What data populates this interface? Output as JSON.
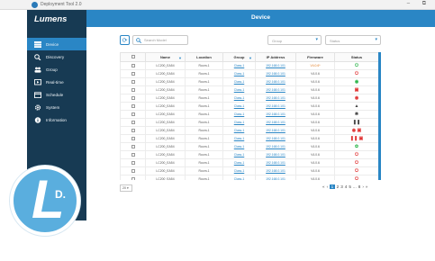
{
  "window": {
    "title": "Deployment Tool 2.0",
    "controls": "– ⧉"
  },
  "sidebar": {
    "brand": "Lumens",
    "items": [
      {
        "label": "Device",
        "icon": "device-icon",
        "active": true
      },
      {
        "label": "Discovery",
        "icon": "search-icon"
      },
      {
        "label": "Group",
        "icon": "group-icon"
      },
      {
        "label": "Real-time",
        "icon": "realtime-icon"
      },
      {
        "label": "Schedule",
        "icon": "calendar-icon"
      },
      {
        "label": "System",
        "icon": "gear-icon"
      },
      {
        "label": "Information",
        "icon": "info-icon"
      }
    ]
  },
  "header": {
    "title": "Device"
  },
  "toolbar": {
    "search_placeholder": "Search Model",
    "filter1": "Group",
    "filter2": "Status"
  },
  "table": {
    "headers": [
      "Name",
      "Location",
      "Group",
      "IP Address",
      "Firmware",
      "Status"
    ],
    "rows": [
      [
        "LC200_EA54",
        "Room-1",
        "Class-1",
        "192.168.0.101",
        "V4.0.6*",
        "status-green-power"
      ],
      [
        "LC200_EA54",
        "Room-1",
        "Class-1",
        "192.168.0.101",
        "V4.0.6",
        "status-red-power"
      ],
      [
        "LC200_EA54",
        "Room-1",
        "Class-1",
        "192.168.0.101",
        "V4.0.6",
        "status-green-record"
      ],
      [
        "LC200_EA54",
        "Room-1",
        "Class-1",
        "192.168.0.101",
        "V4.0.6",
        "status-red-stream"
      ],
      [
        "LC200_EA54",
        "Room-1",
        "Class-1",
        "192.168.0.101",
        "V4.0.6",
        "status-red-record"
      ],
      [
        "LC200_EA54",
        "Room-1",
        "Class-1",
        "192.168.0.101",
        "V4.0.6",
        "status-warning"
      ],
      [
        "LC200_EA54",
        "Room-1",
        "Class-1",
        "192.168.0.101",
        "V4.0.6",
        "status-record-multi"
      ],
      [
        "LC200_EA54",
        "Room-1",
        "Class-1",
        "192.168.0.101",
        "V4.0.6",
        "status-pause"
      ],
      [
        "LC200_EA54",
        "Room-1",
        "Class-1",
        "192.168.0.101",
        "V4.0.6",
        "status-record-stream"
      ],
      [
        "LC200_EA54",
        "Room-1",
        "Class-1",
        "192.168.0.101",
        "V4.0.6",
        "status-pause-stream"
      ],
      [
        "LC200_EA54",
        "Room-1",
        "Class-1",
        "192.168.0.101",
        "V4.0.6",
        "status-record-green"
      ],
      [
        "LC200_EA54",
        "Room-1",
        "Class-1",
        "192.168.0.101",
        "V4.0.6",
        "status-red-power"
      ],
      [
        "LC200_EA54",
        "Room-1",
        "Class-1",
        "192.168.0.101",
        "V4.0.6",
        "status-red-power"
      ],
      [
        "LC200_EA54",
        "Room-1",
        "Class-1",
        "192.168.0.101",
        "V4.0.6",
        "status-red-power"
      ],
      [
        "LC200_EA54",
        "Room-1",
        "Class-1",
        "192.168.0.101",
        "V4.0.6",
        "status-red-power"
      ],
      [
        "LC200_EA54",
        "Room-1",
        "Class-1",
        "192.168.0.101",
        "V4.0.6",
        "status-red-power"
      ]
    ]
  },
  "pager": {
    "page_size": "20",
    "pages": [
      "1",
      "2",
      "3",
      "4",
      "5",
      "...",
      "8"
    ],
    "current": "1"
  },
  "logo": {
    "letter": "L",
    "suffix": "D."
  },
  "colors": {
    "accent": "#2a86c5",
    "sidebar": "#173a53",
    "logo": "#5aaede"
  }
}
